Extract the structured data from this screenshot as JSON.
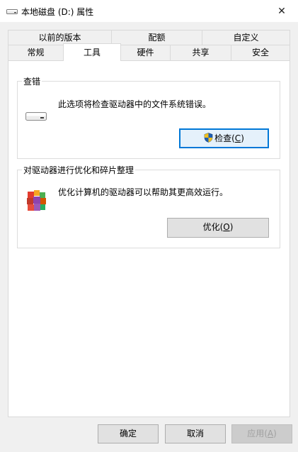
{
  "window": {
    "title": "本地磁盘 (D:) 属性",
    "icon": "drive-icon",
    "close_glyph": "✕"
  },
  "tabs": {
    "row1": [
      {
        "label": "以前的版本"
      },
      {
        "label": "配额"
      },
      {
        "label": "自定义"
      }
    ],
    "row2": [
      {
        "label": "常规"
      },
      {
        "label": "工具"
      },
      {
        "label": "硬件"
      },
      {
        "label": "共享"
      },
      {
        "label": "安全"
      }
    ],
    "active": "工具"
  },
  "check_group": {
    "title": "查错",
    "description": "此选项将检查驱动器中的文件系统错误。",
    "button_label_pre": "检查(",
    "button_label_key": "C",
    "button_label_post": ")",
    "icon": "drive-icon",
    "button_icon": "uac-shield-icon"
  },
  "optimize_group": {
    "title": "对驱动器进行优化和碎片整理",
    "description": "优化计算机的驱动器可以帮助其更高效运行。",
    "button_label_pre": "优化(",
    "button_label_key": "O",
    "button_label_post": ")",
    "icon": "defrag-icon"
  },
  "footer": {
    "ok_label": "确定",
    "cancel_label": "取消",
    "apply_label_pre": "应用(",
    "apply_label_key": "A",
    "apply_label_post": ")"
  },
  "colors": {
    "accent": "#0078d7",
    "window_bg": "#f0f0f0",
    "panel_bg": "#ffffff"
  }
}
